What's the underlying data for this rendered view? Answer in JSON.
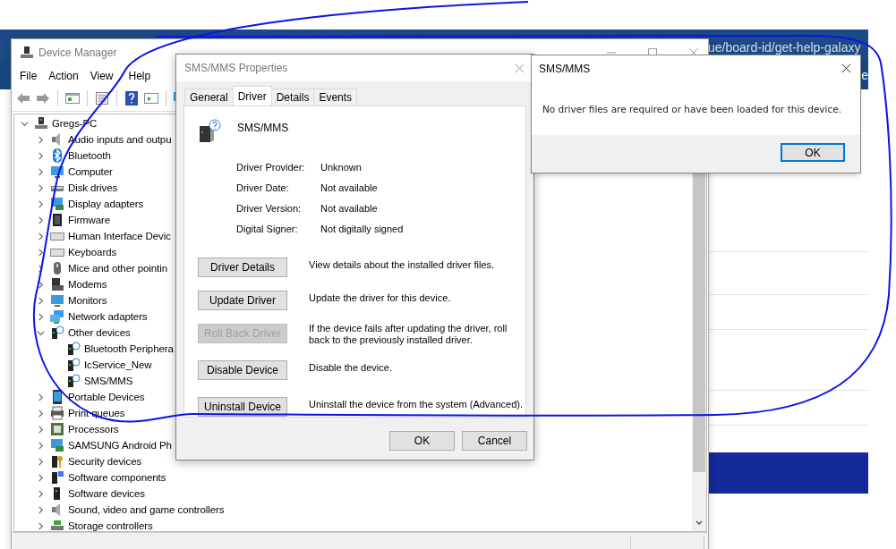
{
  "browser": {
    "address": "ue/board-id/get-help-galaxy",
    "nav_text": "e"
  },
  "device_manager": {
    "title": "Device Manager",
    "menu": [
      "File",
      "Action",
      "View",
      "Help"
    ],
    "tree": {
      "label": "Gregs-PC",
      "expanded": true,
      "children": [
        {
          "label": "Audio inputs and outpu",
          "expanded": false
        },
        {
          "label": "Bluetooth",
          "expanded": false
        },
        {
          "label": "Computer",
          "expanded": false
        },
        {
          "label": "Disk drives",
          "expanded": false
        },
        {
          "label": "Display adapters",
          "expanded": false
        },
        {
          "label": "Firmware",
          "expanded": false
        },
        {
          "label": "Human Interface Devic",
          "expanded": false
        },
        {
          "label": "Keyboards",
          "expanded": false
        },
        {
          "label": "Mice and other pointin",
          "expanded": false
        },
        {
          "label": "Modems",
          "expanded": false
        },
        {
          "label": "Monitors",
          "expanded": false
        },
        {
          "label": "Network adapters",
          "expanded": false
        },
        {
          "label": "Other devices",
          "expanded": true,
          "children": [
            {
              "label": "Bluetooth Periphera"
            },
            {
              "label": "IcService_New"
            },
            {
              "label": "SMS/MMS"
            }
          ]
        },
        {
          "label": "Portable Devices",
          "expanded": false
        },
        {
          "label": "Print queues",
          "expanded": false
        },
        {
          "label": "Processors",
          "expanded": false
        },
        {
          "label": "SAMSUNG Android Ph",
          "expanded": false
        },
        {
          "label": "Security devices",
          "expanded": false
        },
        {
          "label": "Software components",
          "expanded": false
        },
        {
          "label": "Software devices",
          "expanded": false
        },
        {
          "label": "Sound, video and game controllers",
          "expanded": false
        },
        {
          "label": "Storage controllers",
          "expanded": false
        }
      ]
    }
  },
  "properties": {
    "title": "SMS/MMS Properties",
    "tabs": [
      {
        "label": "General",
        "selected": false
      },
      {
        "label": "Driver",
        "selected": true
      },
      {
        "label": "Details",
        "selected": false
      },
      {
        "label": "Events",
        "selected": false
      }
    ],
    "device_name": "SMS/MMS",
    "fields": [
      {
        "label": "Driver Provider:",
        "value": "Unknown"
      },
      {
        "label": "Driver Date:",
        "value": "Not available"
      },
      {
        "label": "Driver Version:",
        "value": "Not available"
      },
      {
        "label": "Digital Signer:",
        "value": "Not digitally signed"
      }
    ],
    "actions": [
      {
        "button": "Driver Details",
        "description": "View details about the installed driver files.",
        "disabled": false
      },
      {
        "button": "Update Driver",
        "description": "Update the driver for this device.",
        "disabled": false
      },
      {
        "button": "Roll Back Driver",
        "description": "If the device fails after updating the driver, roll back to the previously installed driver.",
        "disabled": true
      },
      {
        "button": "Disable Device",
        "description": "Disable the device.",
        "disabled": false
      },
      {
        "button": "Uninstall Device",
        "description": "Uninstall the device from the system (Advanced).",
        "disabled": false
      }
    ],
    "buttons": [
      "OK",
      "Cancel"
    ]
  },
  "message_box": {
    "title": "SMS/MMS",
    "text": "No driver files are required or have been loaded for this device.",
    "button": {
      "label": "OK",
      "focused": true
    }
  }
}
